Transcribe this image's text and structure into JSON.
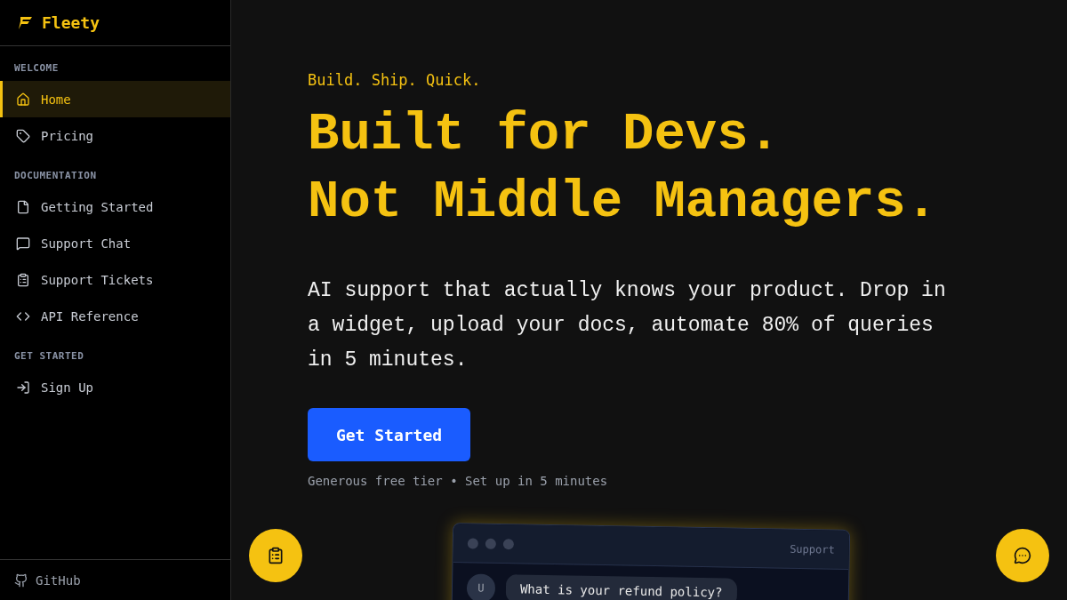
{
  "brand": {
    "name": "Fleety"
  },
  "sidebar": {
    "sections": [
      {
        "title": "WELCOME",
        "items": [
          {
            "label": "Home",
            "kind": "home",
            "selected": true
          },
          {
            "label": "Pricing",
            "kind": "tag",
            "selected": false
          }
        ]
      },
      {
        "title": "DOCUMENTATION",
        "items": [
          {
            "label": "Getting Started",
            "kind": "file",
            "selected": false
          },
          {
            "label": "Support Chat",
            "kind": "chat",
            "selected": false
          },
          {
            "label": "Support Tickets",
            "kind": "clipboard",
            "selected": false
          },
          {
            "label": "API Reference",
            "kind": "code",
            "selected": false
          }
        ]
      },
      {
        "title": "GET STARTED",
        "items": [
          {
            "label": "Sign Up",
            "kind": "login",
            "selected": false
          }
        ]
      }
    ],
    "footer_link": "GitHub"
  },
  "hero": {
    "tagline": "Build. Ship. Quick.",
    "headline": [
      "Built for Devs.",
      "Not Middle Managers."
    ],
    "description": "AI support that actually knows your product. Drop in a widget, upload your docs, automate 80% of queries in 5 minutes.",
    "cta": "Get Started",
    "note": "Generous free tier • Set up in 5 minutes"
  },
  "chat_preview": {
    "title": "Support",
    "messages": [
      {
        "avatar": "U",
        "text": "What is your refund policy?"
      }
    ]
  }
}
